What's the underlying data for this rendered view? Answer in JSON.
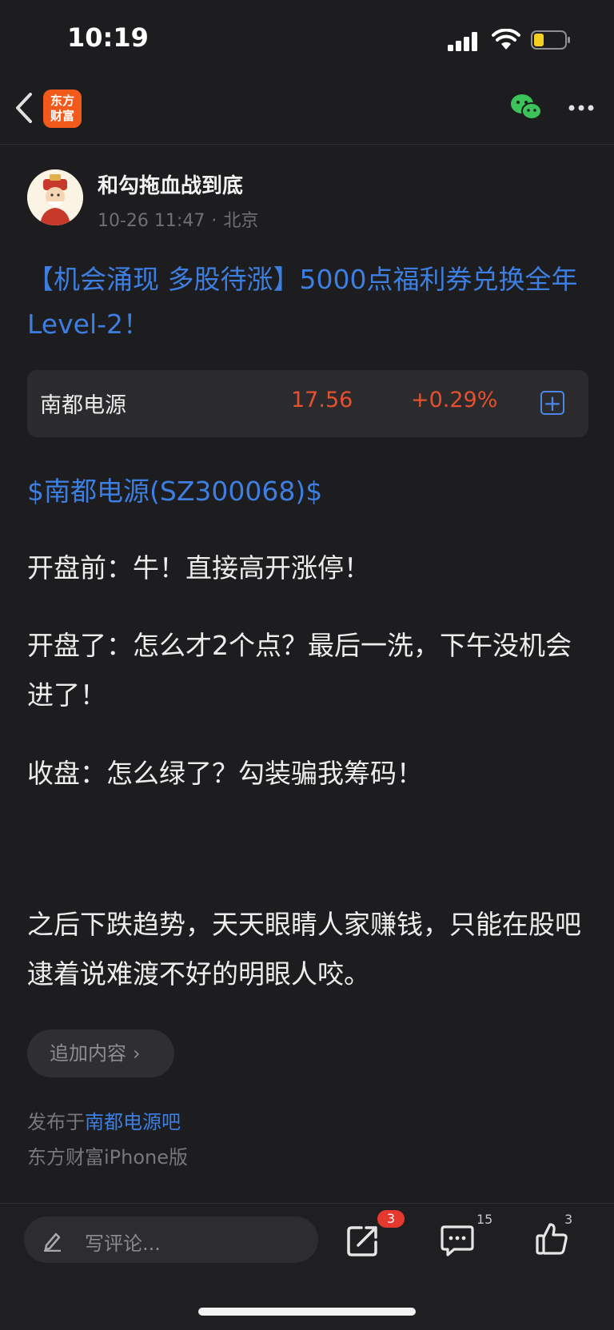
{
  "status_bar": {
    "time": "10:19"
  },
  "nav": {
    "logo_line1": "东方",
    "logo_line2": "财富"
  },
  "post": {
    "author": "和勾拖血战到底",
    "date": "10-26 11:47",
    "location": "北京",
    "title": "【机会涌现 多股待涨】5000点福利券兑换全年Level-2！",
    "stock_card": {
      "name": "南都电源",
      "price": "17.56",
      "change": "+0.29%"
    },
    "stock_link": "$南都电源(SZ300068)$",
    "paragraphs": [
      "开盘前：牛！直接高开涨停！",
      "开盘了：怎么才2个点？最后一洗，下午没机会进了！",
      "收盘：怎么绿了？勾装骗我筹码！",
      "之后下跌趋势，天天眼睛人家赚钱，只能在股吧逮着说难渡不好的明眼人咬。"
    ],
    "append_label": "追加内容",
    "publish_prefix": "发布于",
    "publish_bar": "南都电源吧",
    "client": "东方财富iPhone版"
  },
  "bottom_bar": {
    "comment_placeholder": "写评论...",
    "share_badge": "3",
    "comment_count": "15",
    "like_count": "3"
  },
  "colors": {
    "link": "#3d7ee0",
    "up": "#e5512e",
    "brand": "#f25a1c",
    "wechat": "#3cc35a"
  }
}
